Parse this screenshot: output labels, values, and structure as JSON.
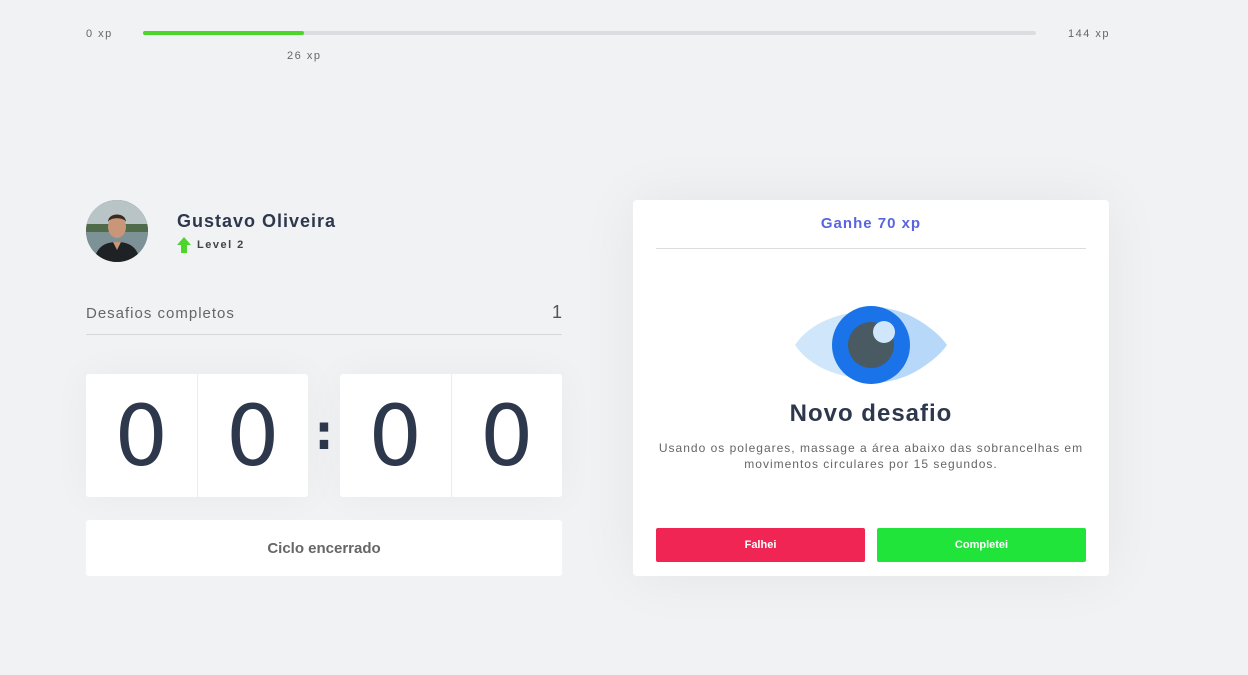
{
  "xp": {
    "min_label": "0 xp",
    "max_label": "144 xp",
    "current_label": "26 xp",
    "current": 26,
    "max": 144,
    "fill_color": "#4cd62b"
  },
  "profile": {
    "name": "Gustavo Oliveira",
    "level_label": "Level 2",
    "level_icon": "level-up-arrow-icon",
    "level_icon_color": "#4cd62b"
  },
  "stats": {
    "completed_label": "Desafios completos",
    "completed_count": "1"
  },
  "countdown": {
    "minutes_tens": "0",
    "minutes_ones": "0",
    "separator": ":",
    "seconds_tens": "0",
    "seconds_ones": "0"
  },
  "cycle_button": {
    "label": "Ciclo encerrado"
  },
  "challenge": {
    "header": "Ganhe 70 xp",
    "icon": "eye-icon",
    "title": "Novo desafio",
    "description": "Usando os polegares, massage a área abaixo das sobrancelhas em movimentos circulares por 15 segundos.",
    "fail_label": "Falhei",
    "success_label": "Completei"
  },
  "colors": {
    "accent": "#5965e0",
    "fail": "#f12554",
    "success": "#21e43a",
    "text": "#2e384d",
    "background": "#f1f2f4"
  }
}
